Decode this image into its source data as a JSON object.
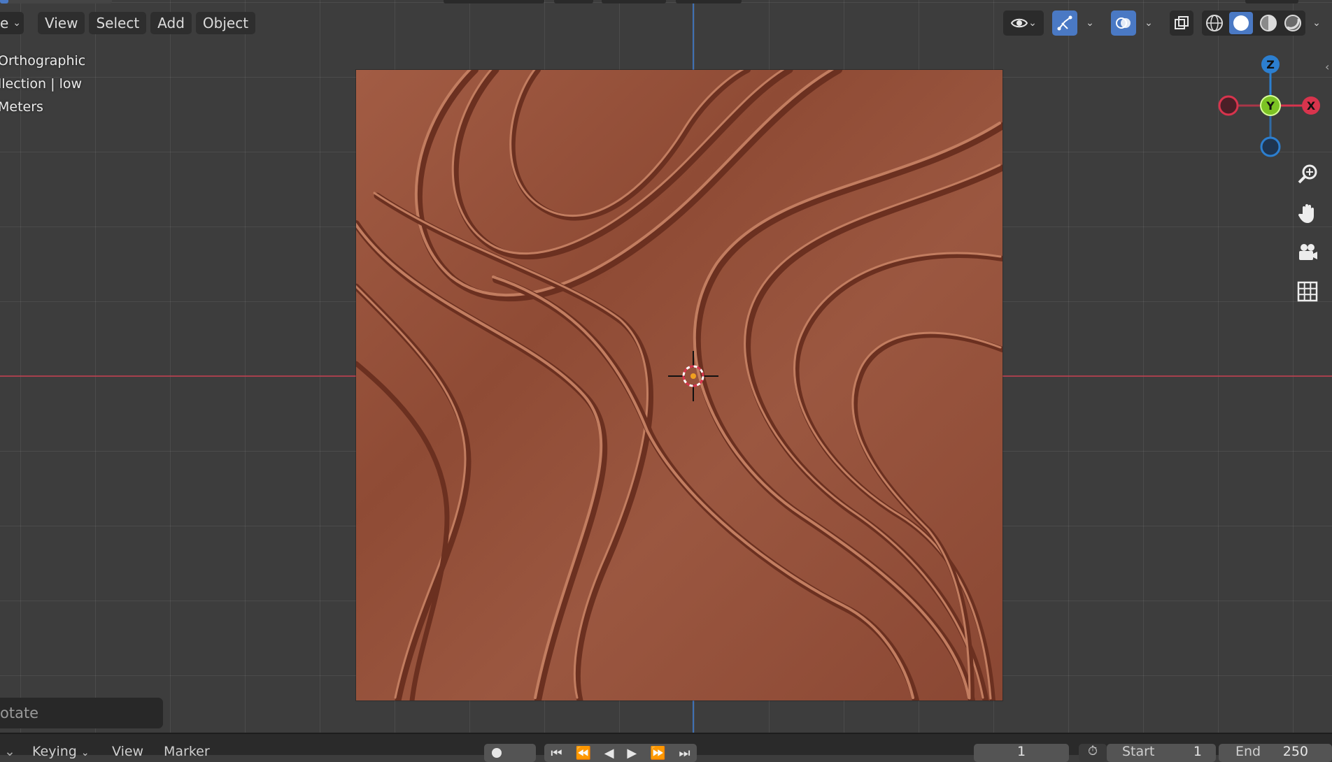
{
  "header": {
    "mode_label": "e",
    "menus": [
      "View",
      "Select",
      "Add",
      "Object"
    ]
  },
  "viewport": {
    "overlay_lines": [
      "Orthographic",
      "llection | low",
      "Meters"
    ],
    "gizmo": {
      "z": "Z",
      "y": "Y",
      "x": "X"
    },
    "colors": {
      "x_axis": "#b9404f",
      "y_axis": "#3f77c2",
      "gizmo_x": "#d8344d",
      "gizmo_y": "#7cc324",
      "gizmo_z": "#2c7fd0",
      "active_tool": "#4a79c4",
      "texture": "#9a5640"
    }
  },
  "operator_panel": {
    "label": "otate"
  },
  "timeline": {
    "keying": "Keying",
    "view": "View",
    "marker": "Marker",
    "current_frame": "1",
    "start_label": "Start",
    "start_value": "1",
    "end_label": "End",
    "end_value": "250"
  },
  "icons": {
    "viewport_tools": [
      "eye-icon",
      "gizmo-icon",
      "overlay-icon",
      "xray-icon",
      "wireframe-shading-icon",
      "solid-shading-icon",
      "material-shading-icon",
      "rendered-shading-icon"
    ],
    "navigation": [
      "zoom-icon",
      "pan-hand-icon",
      "camera-icon",
      "grid-icon"
    ]
  }
}
